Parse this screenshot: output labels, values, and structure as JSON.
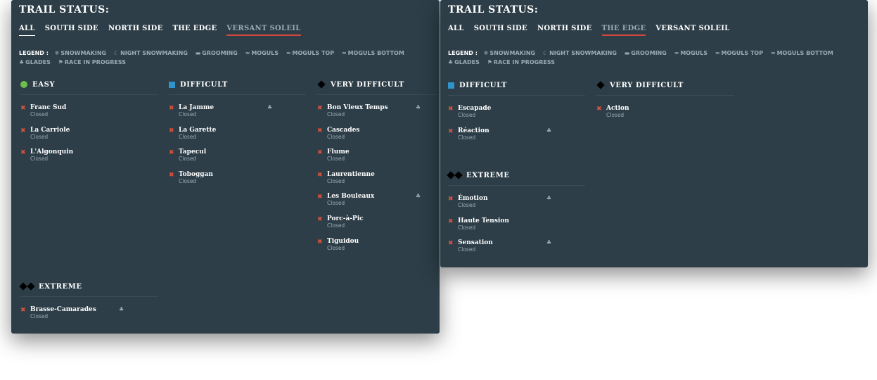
{
  "panel1": {
    "title": "TRAIL STATUS:",
    "tabs": [
      "ALL",
      "SOUTH SIDE",
      "NORTH SIDE",
      "THE EDGE",
      "VERSANT SOLEIL"
    ],
    "legend_label": "LEGEND :",
    "legend": [
      "SNOWMAKING",
      "NIGHT SNOWMAKING",
      "GROOMING",
      "MOGULS",
      "MOGULS TOP",
      "MOGULS BOTTOM",
      "GLADES",
      "RACE IN PROGRESS"
    ],
    "sections": {
      "easy": {
        "title": "EASY",
        "trails": [
          {
            "name": "Franc Sud",
            "status": "Closed"
          },
          {
            "name": "La Carriole",
            "status": "Closed"
          },
          {
            "name": "L'Algonquin",
            "status": "Closed"
          }
        ]
      },
      "difficult": {
        "title": "DIFFICULT",
        "trails": [
          {
            "name": "La Jamme",
            "status": "Closed"
          },
          {
            "name": "La Garette",
            "status": "Closed"
          },
          {
            "name": "Tapecul",
            "status": "Closed"
          },
          {
            "name": "Toboggan",
            "status": "Closed"
          }
        ]
      },
      "very_difficult": {
        "title": "VERY DIFFICULT",
        "trails": [
          {
            "name": "Bon Vieux Temps",
            "status": "Closed"
          },
          {
            "name": "Cascades",
            "status": "Closed"
          },
          {
            "name": "Flume",
            "status": "Closed"
          },
          {
            "name": "Laurentienne",
            "status": "Closed"
          },
          {
            "name": "Les Bouleaux",
            "status": "Closed"
          },
          {
            "name": "Porc-à-Pic",
            "status": "Closed"
          },
          {
            "name": "Tiguidou",
            "status": "Closed"
          }
        ]
      },
      "extreme": {
        "title": "EXTREME",
        "trails": [
          {
            "name": "Brasse-Camarades",
            "status": "Closed"
          }
        ]
      }
    }
  },
  "panel2": {
    "title": "TRAIL STATUS:",
    "tabs": [
      "ALL",
      "SOUTH SIDE",
      "NORTH SIDE",
      "THE EDGE",
      "VERSANT SOLEIL"
    ],
    "legend_label": "LEGEND :",
    "legend": [
      "SNOWMAKING",
      "NIGHT SNOWMAKING",
      "GROOMING",
      "MOGULS",
      "MOGULS TOP",
      "MOGULS BOTTOM",
      "GLADES",
      "RACE IN PROGRESS"
    ],
    "sections": {
      "difficult": {
        "title": "DIFFICULT",
        "trails": [
          {
            "name": "Escapade",
            "status": "Closed"
          },
          {
            "name": "Réaction",
            "status": "Closed"
          }
        ]
      },
      "very_difficult": {
        "title": "VERY DIFFICULT",
        "trails": [
          {
            "name": "Action",
            "status": "Closed"
          }
        ]
      },
      "extreme": {
        "title": "EXTREME",
        "trails": [
          {
            "name": "Émotion",
            "status": "Closed"
          },
          {
            "name": "Haute Tension",
            "status": "Closed"
          },
          {
            "name": "Sensation",
            "status": "Closed"
          }
        ]
      }
    }
  },
  "colors": {
    "panel_bg": "#2d3e48",
    "closed_x": "#d9533c",
    "easy": "#6cc04a",
    "difficult": "#2f94cc",
    "active_tab_underline": "#d4483a",
    "muted_text": "#9aabb5"
  },
  "icons": {
    "legend": [
      "snowflake-icon",
      "night-snowmaking-icon",
      "groomer-icon",
      "moguls-icon",
      "moguls-top-icon",
      "moguls-bottom-icon",
      "glades-icon",
      "flag-icon"
    ],
    "trail": "glades-icon",
    "status": "closed-x-icon"
  }
}
